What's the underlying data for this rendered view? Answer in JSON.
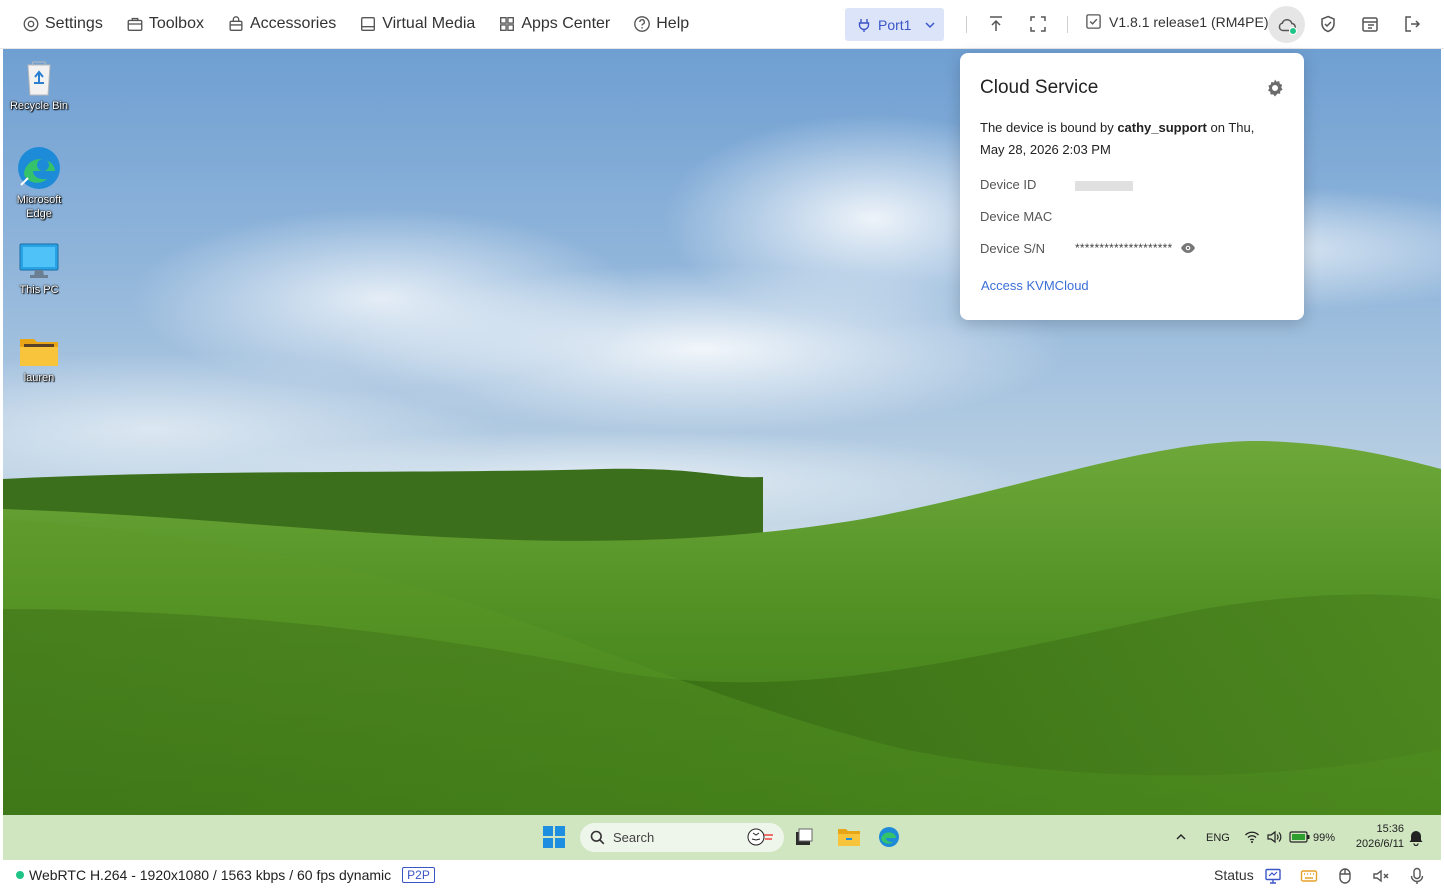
{
  "menu": {
    "items": [
      {
        "label": "Settings",
        "icon": "settings-gear-icon"
      },
      {
        "label": "Toolbox",
        "icon": "toolbox-icon"
      },
      {
        "label": "Accessories",
        "icon": "accessories-bag-icon"
      },
      {
        "label": "Virtual Media",
        "icon": "virtual-media-icon"
      },
      {
        "label": "Apps Center",
        "icon": "apps-grid-icon"
      },
      {
        "label": "Help",
        "icon": "help-circle-icon"
      }
    ]
  },
  "toolbar": {
    "port_label": "Port1",
    "version_label": "V1.8.1 release1 (RM4PE)",
    "icons": [
      "upload-arrow-icon",
      "fullscreen-icon",
      "cloud-icon",
      "shield-check-icon",
      "browser-window-icon",
      "logout-icon"
    ]
  },
  "desktop": {
    "icons": [
      {
        "label": "Recycle Bin",
        "icon": "recycle-bin-icon"
      },
      {
        "label": "Microsoft Edge",
        "icon": "edge-icon"
      },
      {
        "label": "This PC",
        "icon": "monitor-icon"
      },
      {
        "label": "lauren",
        "icon": "folder-icon"
      }
    ]
  },
  "taskbar": {
    "search_placeholder": "Search",
    "language": "ENG",
    "battery": "99%",
    "time": "15:36",
    "date": "2026/6/11"
  },
  "statusbar": {
    "stream_info": "WebRTC H.264 - 1920x1080 /  1563 kbps / 60 fps dynamic",
    "badge": "P2P",
    "status_label": "Status"
  },
  "cloud_popup": {
    "title": "Cloud Service",
    "bound_prefix": "The device is bound by ",
    "bound_user": "cathy_support",
    "bound_suffix": " on Thu, May 28, 2026 2:03 PM",
    "device_id_label": "Device ID",
    "device_mac_label": "Device MAC",
    "device_sn_label": "Device S/N",
    "device_sn_value": "********************",
    "link_label": "Access KVMCloud"
  },
  "colors": {
    "accent": "#3a55c7",
    "online": "#1fc486",
    "taskbar": "#cfe6c0",
    "link": "#3a6fd8"
  }
}
